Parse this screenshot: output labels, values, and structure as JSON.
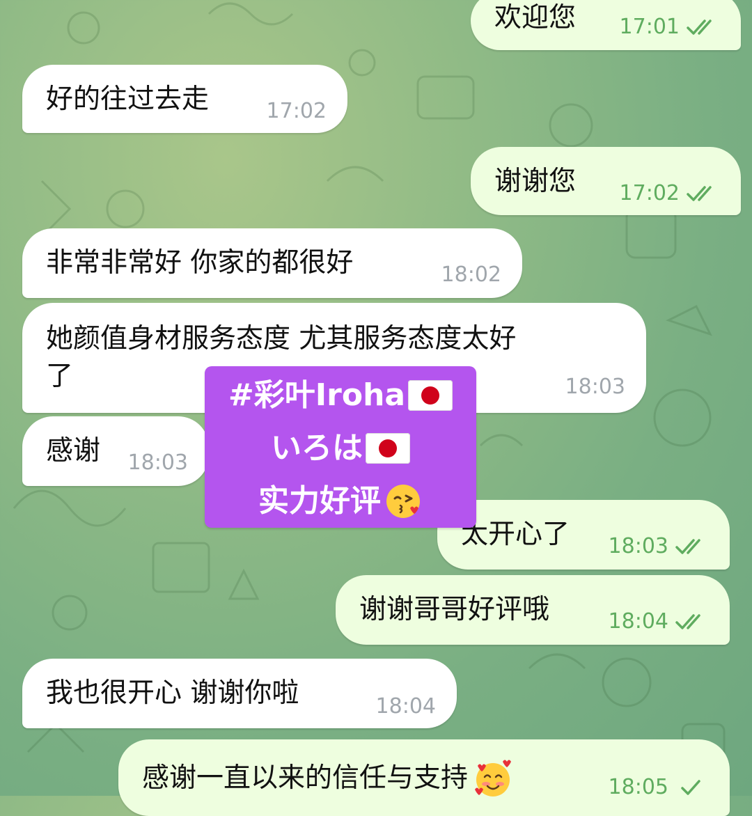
{
  "chat": {
    "messages": [
      {
        "id": "m1",
        "direction": "out",
        "text": "欢迎您",
        "time": "17:01",
        "read": true
      },
      {
        "id": "m2",
        "direction": "in",
        "text": "好的往过去走",
        "time": "17:02"
      },
      {
        "id": "m3",
        "direction": "out",
        "text": "谢谢您",
        "time": "17:02",
        "read": true
      },
      {
        "id": "m4",
        "direction": "in",
        "text": "非常非常好 你家的都很好",
        "time": "18:02"
      },
      {
        "id": "m5",
        "direction": "in",
        "text_line1": "她颜值身材服务态度 尤其服务态度太好",
        "text_line2": "了",
        "time": "18:03"
      },
      {
        "id": "m6",
        "direction": "in",
        "text": "感谢",
        "time": "18:03"
      },
      {
        "id": "m7",
        "direction": "out",
        "text": "太开心了",
        "time": "18:03",
        "read": true
      },
      {
        "id": "m8",
        "direction": "out",
        "text": "谢谢哥哥好评哦",
        "time": "18:04",
        "read": true
      },
      {
        "id": "m9",
        "direction": "in",
        "text": "我也很开心 谢谢你啦",
        "time": "18:04"
      },
      {
        "id": "m10",
        "direction": "out",
        "text": "感谢一直以来的信任与支持",
        "time": "18:05",
        "read": false,
        "emoji": "smiling-face-with-hearts"
      }
    ]
  },
  "sticker": {
    "line1": "#彩叶Iroha",
    "line2": "いろは",
    "line3": "实力好评",
    "flag_icon": "japan-flag-icon",
    "emoji_icon": "face-blowing-kiss-icon",
    "background": "#b455ee"
  },
  "colors": {
    "incoming_bubble": "#ffffff",
    "outgoing_bubble": "#eefedf",
    "outgoing_meta": "#5fac5f",
    "incoming_meta": "#a0a6ac"
  }
}
